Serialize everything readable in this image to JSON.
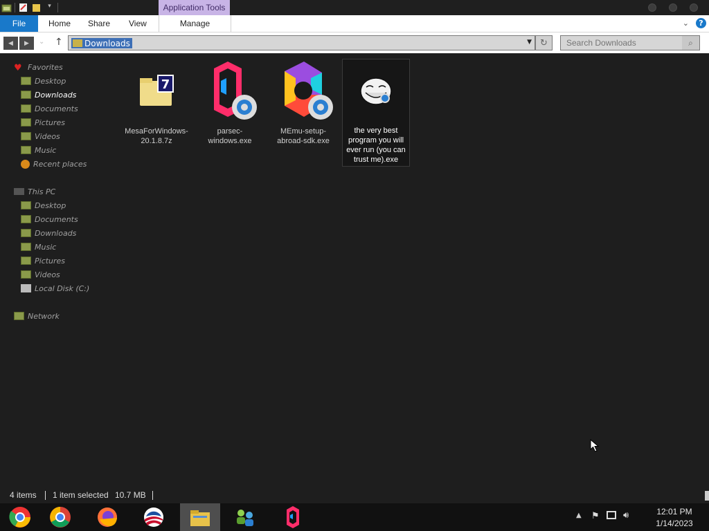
{
  "ribbon": {
    "context_tab": "Application Tools",
    "tabs": [
      {
        "label": "File"
      },
      {
        "label": "Home"
      },
      {
        "label": "Share"
      },
      {
        "label": "View"
      },
      {
        "label": "Manage"
      }
    ]
  },
  "address": {
    "path": "Downloads",
    "search_placeholder": "Search Downloads"
  },
  "sidebar": {
    "favorites": {
      "label": "Favorites",
      "items": [
        "Desktop",
        "Downloads",
        "Documents",
        "Pictures",
        "Videos",
        "Music",
        "Recent places"
      ]
    },
    "this_pc": {
      "label": "This PC",
      "items": [
        "Desktop",
        "Documents",
        "Downloads",
        "Music",
        "Pictures",
        "Videos",
        "Local Disk (C:)"
      ]
    },
    "network": {
      "label": "Network"
    },
    "selected": "Downloads"
  },
  "files": [
    {
      "name": "MesaForWindows-20.1.8.7z",
      "icon": "7z-archive-icon"
    },
    {
      "name": "parsec-windows.exe",
      "icon": "parsec-setup-icon"
    },
    {
      "name": "MEmu-setup-abroad-sdk.exe",
      "icon": "memu-setup-icon"
    },
    {
      "name": "the very best program you will ever run (you can trust me).exe",
      "icon": "trollface-icon",
      "selected": true
    }
  ],
  "status": {
    "item_count": "4 items",
    "selection": "1 item selected",
    "size": "10.7 MB"
  },
  "taskbar": {
    "apps": [
      "chromeos-icon",
      "chrome-icon",
      "firefox-icon",
      "obama-logo-icon",
      "file-explorer-icon",
      "network-people-icon",
      "parsec-icon"
    ],
    "time": "12:01 PM",
    "date": "1/14/2023"
  },
  "colors": {
    "accent": "#1979ca",
    "context_tab": "#c8b4e6",
    "selection": "#3d6fb6",
    "background": "#1e1e1e"
  }
}
